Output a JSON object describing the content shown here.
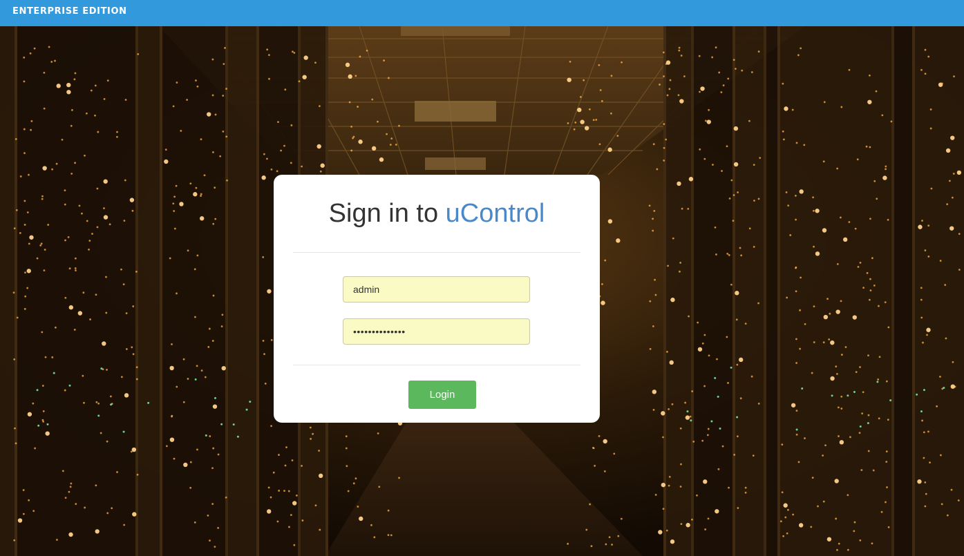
{
  "header": {
    "edition_label": "ENTERPRISE EDITION",
    "bar_color": "#3399dd"
  },
  "background": {
    "scene": "server-room-photo",
    "base_color": "#1a0f04",
    "light_color": "#ffb347"
  },
  "login_card": {
    "title_prefix": "Sign in to ",
    "title_brand": "uControl",
    "brand_color": "#4a89c9",
    "username": {
      "value": "admin"
    },
    "password": {
      "value": "••••••••••••••"
    },
    "login_label": "Login",
    "login_color": "#5cb85c"
  }
}
